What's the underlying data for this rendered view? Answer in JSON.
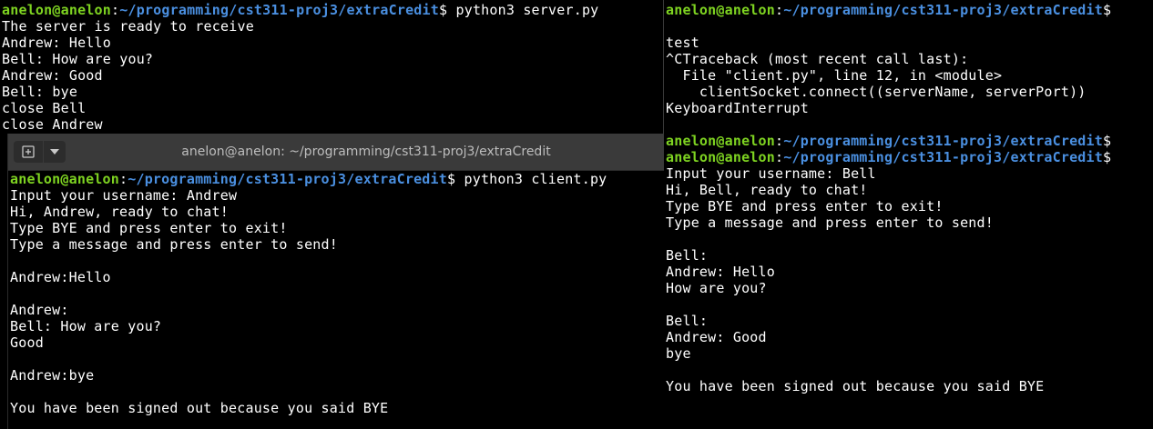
{
  "colors": {
    "user": "#7ed321",
    "path": "#4a8fe0",
    "text": "#ffffff",
    "titlebar": "#3a3a3a"
  },
  "server": {
    "lines": [
      [
        {
          "text": "anelon@anelon",
          "style": "u"
        },
        {
          "text": ":",
          "style": "t"
        },
        {
          "text": "~/programming/cst311-proj3/extraCredit",
          "style": "p"
        },
        {
          "text": "$ python3 server.py",
          "style": "t"
        }
      ],
      [
        {
          "text": "The server is ready to receive",
          "style": "t"
        }
      ],
      [
        {
          "text": "Andrew: Hello",
          "style": "t"
        }
      ],
      [
        {
          "text": "Bell: How are you?",
          "style": "t"
        }
      ],
      [
        {
          "text": "Andrew: Good",
          "style": "t"
        }
      ],
      [
        {
          "text": "Bell: bye",
          "style": "t"
        }
      ],
      [
        {
          "text": "close Bell",
          "style": "t"
        }
      ],
      [
        {
          "text": "close Andrew",
          "style": "t"
        }
      ]
    ]
  },
  "right": {
    "lines": [
      [
        {
          "text": "anelon@anelon",
          "style": "u"
        },
        {
          "text": ":",
          "style": "t"
        },
        {
          "text": "~/programming/cst311-proj3/extraCredit",
          "style": "p"
        },
        {
          "text": "$",
          "style": "t"
        }
      ],
      [],
      [
        {
          "text": "test",
          "style": "t"
        }
      ],
      [
        {
          "text": "^CTraceback (most recent call last):",
          "style": "t"
        }
      ],
      [
        {
          "text": "  File \"client.py\", line 12, in <module>",
          "style": "t"
        }
      ],
      [
        {
          "text": "    clientSocket.connect((serverName, serverPort))",
          "style": "t"
        }
      ],
      [
        {
          "text": "KeyboardInterrupt",
          "style": "t"
        }
      ],
      [],
      [
        {
          "text": "anelon@anelon",
          "style": "u"
        },
        {
          "text": ":",
          "style": "t"
        },
        {
          "text": "~/programming/cst311-proj3/extraCredit",
          "style": "p"
        },
        {
          "text": "$",
          "style": "t"
        }
      ],
      [
        {
          "text": "anelon@anelon",
          "style": "u"
        },
        {
          "text": ":",
          "style": "t"
        },
        {
          "text": "~/programming/cst311-proj3/extraCredit",
          "style": "p"
        },
        {
          "text": "$",
          "style": "t"
        }
      ],
      [
        {
          "text": "Input your username: Bell",
          "style": "t"
        }
      ],
      [
        {
          "text": "Hi, Bell, ready to chat!",
          "style": "t"
        }
      ],
      [
        {
          "text": "Type BYE and press enter to exit!",
          "style": "t"
        }
      ],
      [
        {
          "text": "Type a message and press enter to send!",
          "style": "t"
        }
      ],
      [],
      [
        {
          "text": "Bell:",
          "style": "t"
        }
      ],
      [
        {
          "text": "Andrew: Hello",
          "style": "t"
        }
      ],
      [
        {
          "text": "How are you?",
          "style": "t"
        }
      ],
      [],
      [
        {
          "text": "Bell:",
          "style": "t"
        }
      ],
      [
        {
          "text": "Andrew: Good",
          "style": "t"
        }
      ],
      [
        {
          "text": "bye",
          "style": "t"
        }
      ],
      [],
      [
        {
          "text": "You have been signed out because you said BYE",
          "style": "t"
        }
      ]
    ]
  },
  "client": {
    "title": "anelon@anelon: ~/programming/cst311-proj3/extraCredit",
    "newtab_icon": "new-tab-icon",
    "menu_icon": "chevron-down-icon",
    "lines": [
      [
        {
          "text": "anelon@anelon",
          "style": "u"
        },
        {
          "text": ":",
          "style": "t"
        },
        {
          "text": "~/programming/cst311-proj3/extraCredit",
          "style": "p"
        },
        {
          "text": "$ python3 client.py",
          "style": "t"
        }
      ],
      [
        {
          "text": "Input your username: Andrew",
          "style": "t"
        }
      ],
      [
        {
          "text": "Hi, Andrew, ready to chat!",
          "style": "t"
        }
      ],
      [
        {
          "text": "Type BYE and press enter to exit!",
          "style": "t"
        }
      ],
      [
        {
          "text": "Type a message and press enter to send!",
          "style": "t"
        }
      ],
      [],
      [
        {
          "text": "Andrew:Hello",
          "style": "t"
        }
      ],
      [],
      [
        {
          "text": "Andrew:",
          "style": "t"
        }
      ],
      [
        {
          "text": "Bell: How are you?",
          "style": "t"
        }
      ],
      [
        {
          "text": "Good",
          "style": "t"
        }
      ],
      [],
      [
        {
          "text": "Andrew:bye",
          "style": "t"
        }
      ],
      [],
      [
        {
          "text": "You have been signed out because you said BYE",
          "style": "t"
        }
      ]
    ]
  }
}
